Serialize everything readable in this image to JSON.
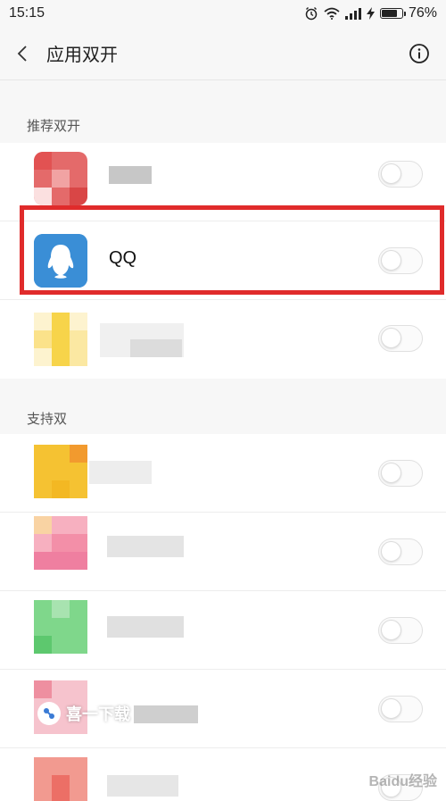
{
  "status_bar": {
    "time": "15:15",
    "battery_percent_label": "76%",
    "battery_level": 0.76
  },
  "header": {
    "title": "应用双开"
  },
  "sections": {
    "recommended_title": "推荐双开",
    "supported_title": "支持双"
  },
  "recommended_apps": [
    {
      "name": "",
      "icon": "blurred-app-icon-red",
      "enabled": false
    },
    {
      "name": "QQ",
      "icon": "qq-penguin-icon",
      "enabled": false
    },
    {
      "name": "",
      "icon": "blurred-app-icon-yellow",
      "enabled": false
    }
  ],
  "supported_apps": [
    {
      "name": "",
      "icon": "blurred-app-icon-yellow",
      "enabled": false
    },
    {
      "name": "",
      "icon": "blurred-app-icon-pink",
      "enabled": false
    },
    {
      "name": "",
      "icon": "blurred-app-icon-green",
      "enabled": false
    },
    {
      "name": "",
      "icon": "blurred-app-icon-pink",
      "enabled": false
    },
    {
      "name": "",
      "icon": "blurred-app-icon-red",
      "enabled": false
    }
  ],
  "watermark": {
    "text": "喜一下载",
    "brand": "Baidu经验"
  },
  "colors": {
    "highlight": "#e02b2b",
    "qq_icon_bg": "#3a8ed6"
  }
}
